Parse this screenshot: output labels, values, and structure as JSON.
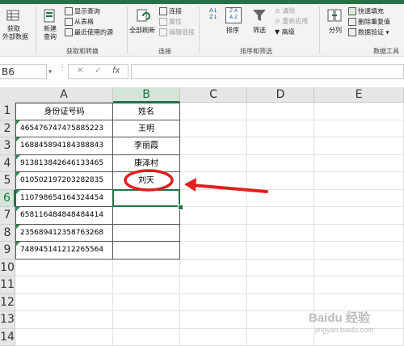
{
  "ribbon": {
    "get_data": [
      "获取",
      "外部数据"
    ],
    "new_query": [
      "新建",
      "查询"
    ],
    "show_queries": "显示查询",
    "from_table": "从表格",
    "recent_sources": "最近使用的源",
    "group_get_transform": "获取和转换",
    "refresh_all": "全部刷新",
    "connections": "连接",
    "properties": "属性",
    "edit_links": "编辑链接",
    "group_connections": "连接",
    "sort": "排序",
    "filter": "筛选",
    "clear": "清除",
    "reapply": "重新应用",
    "advanced": "高级",
    "group_sort_filter": "排序和筛选",
    "text_to_columns": "分列",
    "flash_fill": "快速填充",
    "remove_duplicates": "删除重复值",
    "data_validation": "数据验证",
    "group_data_tools": "数据工具"
  },
  "formula_bar": {
    "name_box": "B6",
    "fx": "fx",
    "cancel": "✕",
    "enter": "✓",
    "content": ""
  },
  "columns": [
    "A",
    "B",
    "C",
    "D",
    "E"
  ],
  "rows": [
    "1",
    "2",
    "3",
    "4",
    "5",
    "6",
    "7",
    "8",
    "9",
    "10",
    "11",
    "12",
    "13",
    "14"
  ],
  "table": {
    "header_a": "身份证号码",
    "header_b": "姓名",
    "ids": [
      "465476747475885223",
      "168845894184388843",
      "913813842646133465",
      "010502197203282835",
      "110798654164324454",
      "658116484848484414",
      "235689412358763268",
      "748945141212265564"
    ],
    "names": [
      "王明",
      "李丽霞",
      "康泽村",
      "刘天",
      "",
      "",
      "",
      ""
    ]
  },
  "selected_cell": "B6",
  "annotation": {
    "circle_color": "#e02020",
    "arrow_color": "#e02020"
  },
  "watermark": "Baidu 经验",
  "watermark_url": "jingyan.baidu.com"
}
